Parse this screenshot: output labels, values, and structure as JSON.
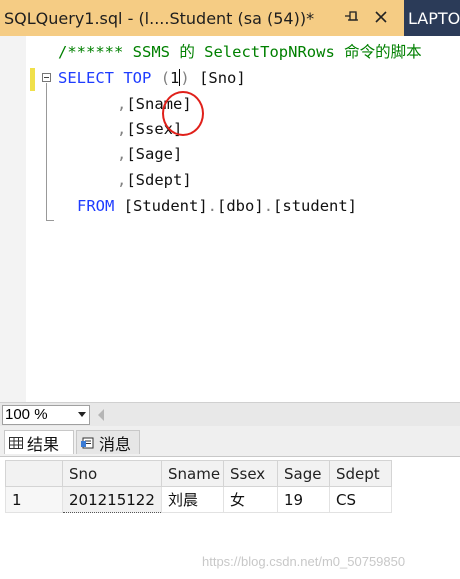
{
  "tab": {
    "title": "SQLQuery1.sql - (l....Student (sa (54))*",
    "pin_icon": "pin-icon",
    "close_icon": "close-icon",
    "other_tab_title": "LAPTOP"
  },
  "editor": {
    "comment": "/****** SSMS 的 SelectTopNRows 命令的脚本",
    "line1": {
      "select": "SELECT",
      "top": "TOP",
      "open": "(",
      "number": "1",
      "close": ")",
      "column": "[Sno]"
    },
    "columns": [
      {
        "comma": ",",
        "name": "[Sname]"
      },
      {
        "comma": ",",
        "name": "[Ssex]"
      },
      {
        "comma": ",",
        "name": "[Sage]"
      },
      {
        "comma": ",",
        "name": "[Sdept]"
      }
    ],
    "from_line": {
      "from": "FROM",
      "db": "[Student]",
      "schema": "[dbo]",
      "table": "[student]",
      "dot": "."
    }
  },
  "zoom": {
    "value": "100 %"
  },
  "result_tabs": {
    "results_label": "结果",
    "messages_label": "消息"
  },
  "grid": {
    "headers": [
      "",
      "Sno",
      "Sname",
      "Ssex",
      "Sage",
      "Sdept"
    ],
    "rows": [
      [
        "1",
        "201215122",
        "刘晨",
        "女",
        "19",
        "CS"
      ]
    ]
  },
  "watermark": "https://blog.csdn.net/m0_50759850",
  "colors": {
    "tab_active": "#f5cc84",
    "tabbar": "#2b3b58",
    "keyword": "#1e3cff",
    "comment": "#008000",
    "annotation_circle": "#e0201a"
  }
}
